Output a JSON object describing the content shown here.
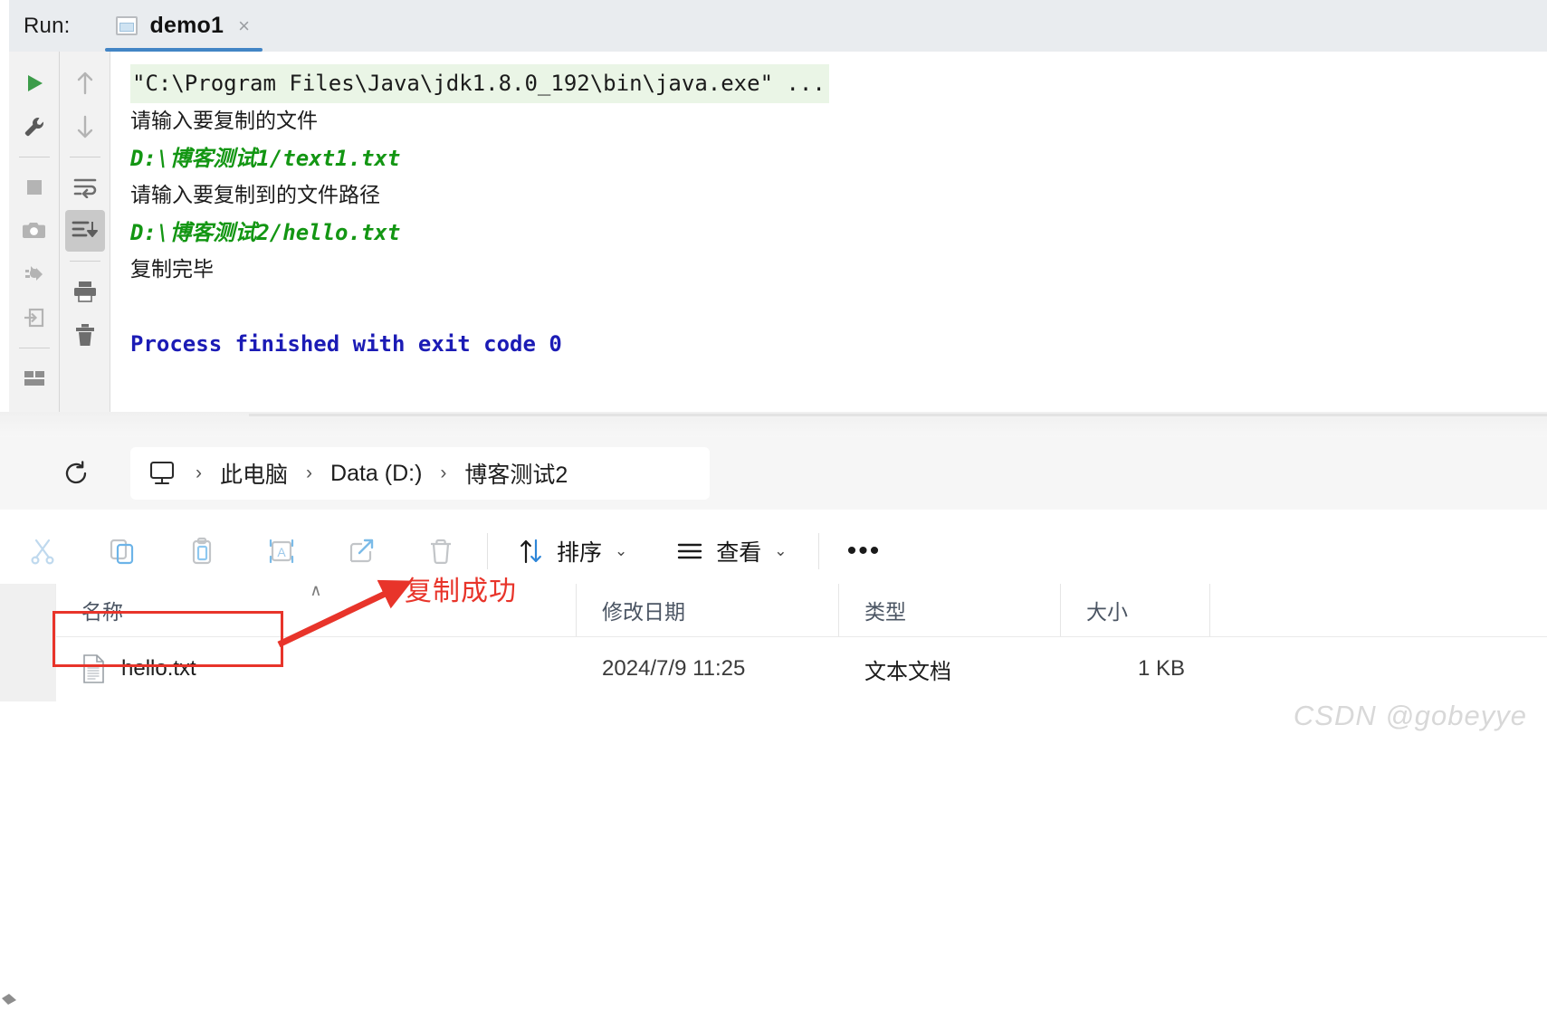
{
  "ide": {
    "run_label": "Run:",
    "tab": {
      "label": "demo1",
      "close": "×",
      "icon": "run-config-icon"
    },
    "left_toolbar": [
      {
        "name": "rerun-icon",
        "title": "Rerun"
      },
      {
        "name": "wrench-icon",
        "title": "Edit Configuration"
      },
      {
        "name": "stop-icon",
        "title": "Stop"
      },
      {
        "name": "camera-icon",
        "title": "Capture Memory Snapshot"
      },
      {
        "name": "debug-attach-icon",
        "title": "Attach Debugger"
      },
      {
        "name": "import-icon",
        "title": "Import"
      },
      {
        "name": "layout-icon",
        "title": "Layout Settings"
      }
    ],
    "right_toolbar": [
      {
        "name": "arrow-up-icon",
        "title": "Up the Stack Trace"
      },
      {
        "name": "arrow-down-icon",
        "title": "Down the Stack Trace"
      },
      {
        "name": "soft-wrap-icon",
        "title": "Soft-Wrap"
      },
      {
        "name": "scroll-to-end-icon",
        "title": "Scroll to the end",
        "active": true
      },
      {
        "name": "print-icon",
        "title": "Print"
      },
      {
        "name": "trash-icon",
        "title": "Clear All"
      }
    ],
    "console_lines": [
      {
        "text": "\"C:\\Program Files\\Java\\jdk1.8.0_192\\bin\\java.exe\" ...",
        "style": "cmd"
      },
      {
        "text": "请输入要复制的文件",
        "style": "zh"
      },
      {
        "text": "D:\\博客测试1/text1.txt",
        "style": "green-italic"
      },
      {
        "text": "请输入要复制到的文件路径",
        "style": "zh"
      },
      {
        "text": "D:\\博客测试2/hello.txt",
        "style": "green-italic"
      },
      {
        "text": "复制完毕",
        "style": "zh"
      },
      {
        "text": "",
        "style": "blank"
      },
      {
        "text": "Process finished with exit code 0",
        "style": "finish"
      }
    ]
  },
  "explorer": {
    "refresh_icon": "refresh-icon",
    "breadcrumb": {
      "home_icon": "this-pc-monitor-icon",
      "separator": "›",
      "items": [
        "此电脑",
        "Data (D:)",
        "博客测试2"
      ]
    },
    "commandbar": {
      "icons": [
        {
          "name": "cut-icon"
        },
        {
          "name": "copy-icon"
        },
        {
          "name": "paste-icon"
        },
        {
          "name": "rename-icon"
        },
        {
          "name": "share-icon"
        },
        {
          "name": "delete-icon"
        }
      ],
      "sort_label": "排序",
      "sort_icon": "sort-arrows-icon",
      "view_label": "查看",
      "view_icon": "view-lines-icon",
      "chevron": "⌄",
      "more_label": "•••"
    },
    "columns": {
      "name": "名称",
      "date": "修改日期",
      "type": "类型",
      "size": "大小",
      "sort_caret": "∧"
    },
    "files": [
      {
        "icon": "text-file-icon",
        "name": "hello.txt",
        "date": "2024/7/9 11:25",
        "type": "文本文档",
        "size": "1 KB"
      }
    ]
  },
  "annotation": {
    "text": "复制成功",
    "color": "#e8342a"
  },
  "watermark": {
    "text": "CSDN @gobeyye"
  },
  "colors": {
    "tab_accent": "#4285c5",
    "console_cmd_bg": "#eaf5e6",
    "console_green": "#139613",
    "console_blue": "#1b1bb5",
    "annotation_red": "#e8342a",
    "run_icon_green": "#3c9c4a"
  }
}
